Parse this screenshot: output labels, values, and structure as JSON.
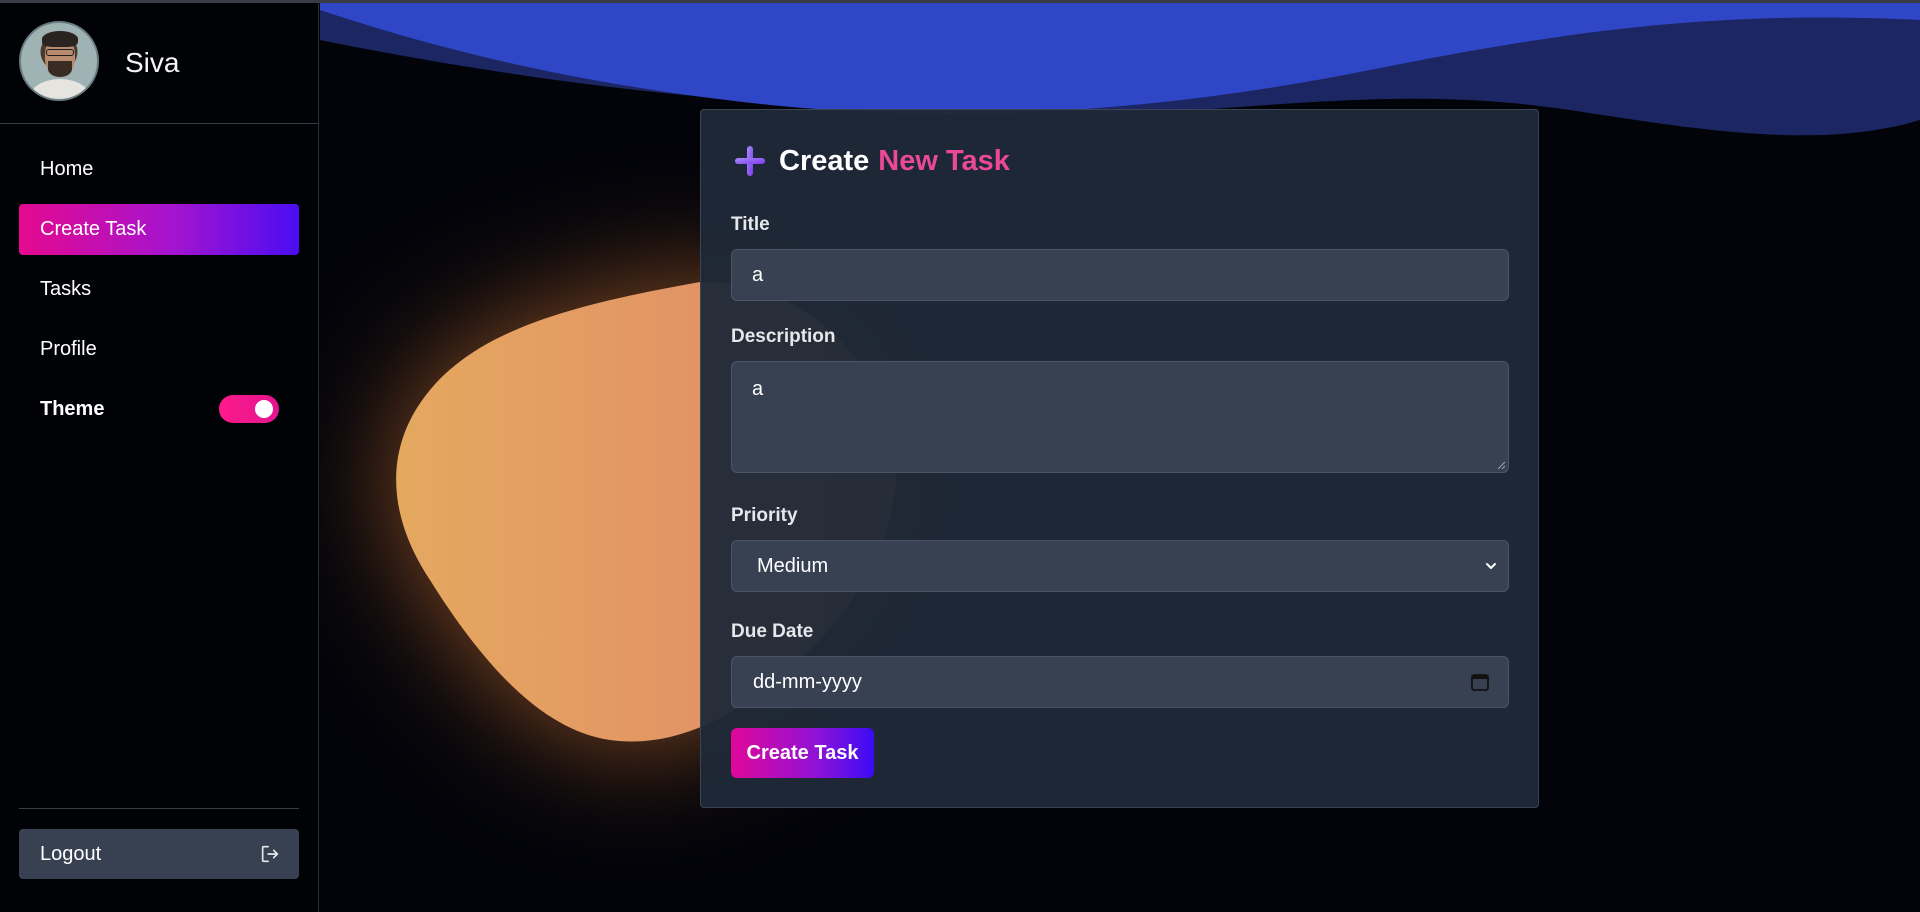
{
  "user": {
    "name": "Siva"
  },
  "sidebar": {
    "items": [
      {
        "label": "Home"
      },
      {
        "label": "Create Task"
      },
      {
        "label": "Tasks"
      },
      {
        "label": "Profile"
      }
    ],
    "theme_label": "Theme",
    "theme_toggle_on": true,
    "logout_label": "Logout"
  },
  "form": {
    "heading_part1": "Create",
    "heading_part2": "New Task",
    "title_label": "Title",
    "title_value": "a",
    "description_label": "Description",
    "description_value": "a",
    "priority_label": "Priority",
    "priority_value": "Medium",
    "due_date_label": "Due Date",
    "due_date_placeholder": "dd-mm-yyyy",
    "submit_label": "Create Task"
  },
  "colors": {
    "accent_pink": "#ec4899",
    "gradient_start": "#e5098f",
    "gradient_end": "#4a0df2",
    "card_bg": "#1f2937",
    "field_bg": "#374152"
  },
  "icons": [
    "plus-icon",
    "logout-icon",
    "chevron-down-icon",
    "calendar-icon"
  ]
}
